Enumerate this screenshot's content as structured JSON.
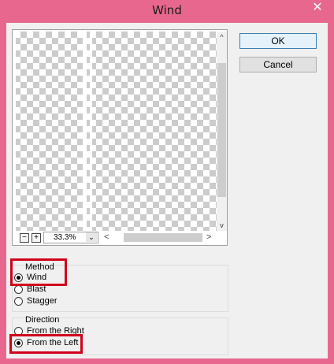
{
  "window": {
    "title": "Wind",
    "close_glyph": "✕"
  },
  "preview": {
    "zoom_value": "33.3%",
    "zoom_minus": "−",
    "zoom_plus": "+",
    "zoom_dropdown_glyph": "⌄",
    "scroll_left_glyph": "<",
    "scroll_right_glyph": ">",
    "scroll_up_glyph": "^",
    "scroll_down_glyph": "v"
  },
  "buttons": {
    "ok_label": "OK",
    "cancel_label": "Cancel"
  },
  "method": {
    "label": "Method",
    "options": [
      {
        "label": "Wind",
        "selected": true
      },
      {
        "label": "Blast",
        "selected": false
      },
      {
        "label": "Stagger",
        "selected": false
      }
    ]
  },
  "direction": {
    "label": "Direction",
    "options": [
      {
        "label": "From the Right",
        "selected": false
      },
      {
        "label": "From the Left",
        "selected": true
      }
    ]
  },
  "colors": {
    "title_bar": "#e8678f",
    "highlight": "#d0011b"
  }
}
